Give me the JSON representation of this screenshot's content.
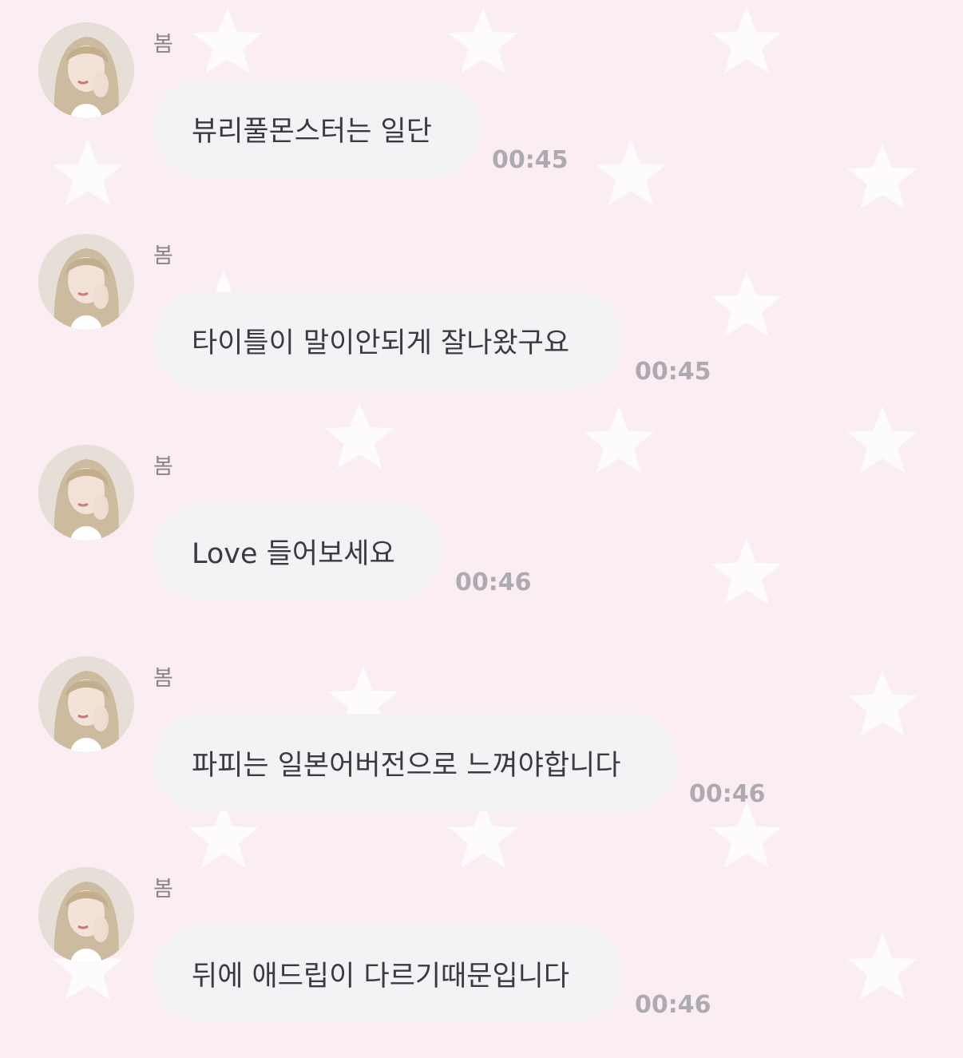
{
  "chat": {
    "messages": [
      {
        "sender": "봄",
        "text": "뷰리풀몬스터는 일단",
        "time": "00:45"
      },
      {
        "sender": "봄",
        "text": "타이틀이 말이안되게 잘나왔구요",
        "time": "00:45"
      },
      {
        "sender": "봄",
        "text": "Love 들어보세요",
        "time": "00:46"
      },
      {
        "sender": "봄",
        "text": "파피는 일본어버전으로 느껴야합니다",
        "time": "00:46"
      },
      {
        "sender": "봄",
        "text": "뒤에 애드립이 다르기때문입니다",
        "time": "00:46"
      }
    ]
  },
  "colors": {
    "background": "#fbeef2",
    "bubble": "#f3f2f5",
    "message_text": "#3a3a3f",
    "timestamp": "#aeaab2",
    "sender_name": "#8a8388",
    "star": "#ffffff"
  },
  "icons": {
    "background_pattern": "star-icon"
  }
}
